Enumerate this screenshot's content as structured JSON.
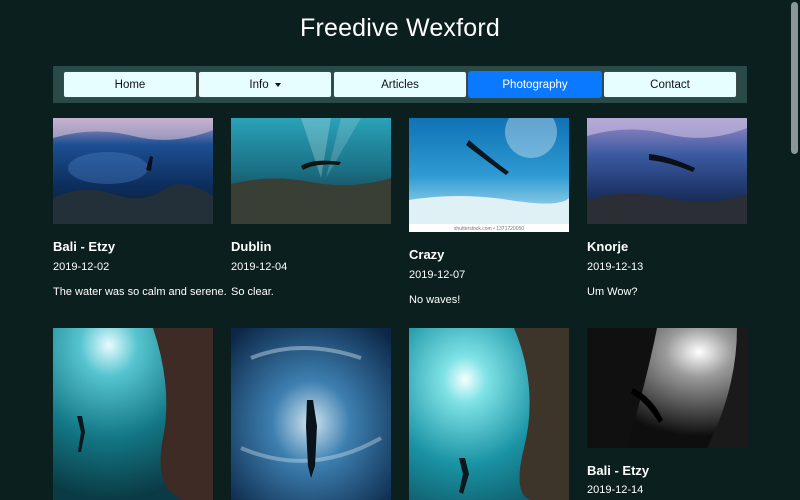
{
  "site": {
    "title": "Freedive Wexford"
  },
  "nav": {
    "items": [
      {
        "label": "Home",
        "active": false
      },
      {
        "label": "Info",
        "active": false,
        "dropdown": true
      },
      {
        "label": "Articles",
        "active": false
      },
      {
        "label": "Photography",
        "active": true
      },
      {
        "label": "Contact",
        "active": false
      }
    ]
  },
  "gallery": {
    "cards": [
      {
        "title": "Bali - Etzy",
        "date": "2019-12-02",
        "desc": "The water was so calm and serene."
      },
      {
        "title": "Dublin",
        "date": "2019-12-04",
        "desc": "So clear."
      },
      {
        "title": "Crazy",
        "date": "2019-12-07",
        "desc": "No waves!",
        "watermark": "shutterstock.com • 1371720050"
      },
      {
        "title": "Knorje",
        "date": "2019-12-13",
        "desc": "Um Wow?"
      },
      {
        "title": "",
        "date": "",
        "desc": ""
      },
      {
        "title": "",
        "date": "",
        "desc": ""
      },
      {
        "title": "",
        "date": "",
        "desc": ""
      },
      {
        "title": "Bali - Etzy",
        "date": "2019-12-14",
        "desc": ""
      }
    ]
  },
  "colors": {
    "background": "#0b1f1e",
    "nav_bg": "#2a4a48",
    "nav_button": "#e6feff",
    "nav_active": "#0b79ff"
  }
}
